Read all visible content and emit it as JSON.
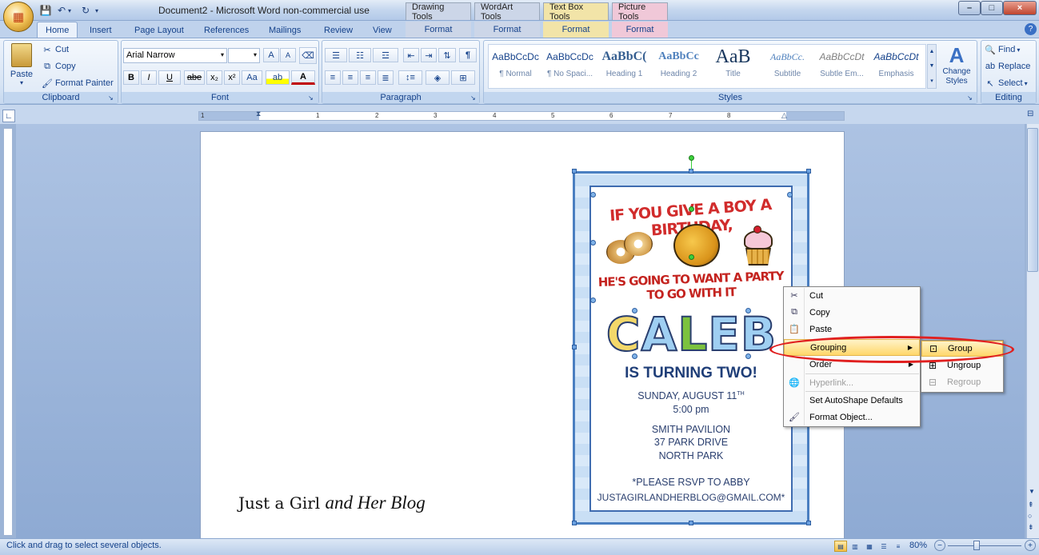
{
  "window": {
    "title": "Document2 - Microsoft Word non-commercial use",
    "context_tabs": [
      "Drawing Tools",
      "WordArt Tools",
      "Text Box Tools",
      "Picture Tools"
    ],
    "context_colors": [
      "#ccd6e8",
      "#ccd6e8",
      "#f2e4a8",
      "#f0c8d8"
    ],
    "minimize": "–",
    "maximize": "□",
    "close": "×"
  },
  "tabs": [
    "Home",
    "Insert",
    "Page Layout",
    "References",
    "Mailings",
    "Review",
    "View"
  ],
  "context_format_tabs": [
    "Format",
    "Format",
    "Format",
    "Format"
  ],
  "clipboard": {
    "paste": "Paste",
    "cut": "Cut",
    "copy": "Copy",
    "format_painter": "Format Painter",
    "label": "Clipboard"
  },
  "font": {
    "name": "Arial Narrow",
    "size": "",
    "label": "Font",
    "bold": "B",
    "italic": "I",
    "underline": "U",
    "strike": "abe",
    "subscript": "x₂",
    "superscript": "x²",
    "change_case": "Aa",
    "grow": "A",
    "shrink": "A"
  },
  "paragraph": {
    "label": "Paragraph"
  },
  "styles": {
    "label": "Styles",
    "items": [
      {
        "sample": "AaBbCcDc",
        "name": "¶ Normal"
      },
      {
        "sample": "AaBbCcDc",
        "name": "¶ No Spaci..."
      },
      {
        "sample": "AaBbC(",
        "name": "Heading 1"
      },
      {
        "sample": "AaBbCc",
        "name": "Heading 2"
      },
      {
        "sample": "AaB",
        "name": "Title"
      },
      {
        "sample": "AaBbCc.",
        "name": "Subtitle"
      },
      {
        "sample": "AaBbCcDt",
        "name": "Subtle Em..."
      },
      {
        "sample": "AaBbCcDt",
        "name": "Emphasis"
      }
    ],
    "change_styles": "Change Styles"
  },
  "editing": {
    "label": "Editing",
    "find": "Find",
    "replace": "Replace",
    "select": "Select"
  },
  "ruler_numbers": [
    "1",
    "1",
    "2",
    "3",
    "4",
    "5",
    "6",
    "7",
    "8"
  ],
  "invitation": {
    "headline": "IF YOU GIVE A BOY A BIRTHDAY,",
    "subheadline": "HE'S GOING TO WANT A PARTY TO GO WITH IT",
    "name_letters": [
      {
        "ch": "C",
        "color": "#f3d86a"
      },
      {
        "ch": "A",
        "color": "#9fcff2"
      },
      {
        "ch": "L",
        "color": "#7cc23e"
      },
      {
        "ch": "E",
        "color": "#9fcff2"
      },
      {
        "ch": "B",
        "color": "#9fcff2"
      }
    ],
    "turning": "IS TURNING TWO!",
    "date": "SUNDAY, AUGUST 11",
    "date_sup": "TH",
    "time": "5:00 pm",
    "venue": "SMITH PAVILION",
    "street": "37 PARK DRIVE",
    "area": "NORTH PARK",
    "rsvp": "*PLEASE RSVP TO ABBY",
    "email": "JUSTAGIRLANDHERBLOG@GMAIL.COM*"
  },
  "context_menu": {
    "items": [
      {
        "label": "Cut",
        "icon": "scissors-icon",
        "glyph": "✂"
      },
      {
        "label": "Copy",
        "icon": "copy-icon",
        "glyph": "⧉"
      },
      {
        "label": "Paste",
        "icon": "paste-icon",
        "glyph": "📋"
      },
      {
        "label": "Grouping",
        "icon": "",
        "glyph": ""
      },
      {
        "label": "Order",
        "icon": "",
        "glyph": ""
      },
      {
        "label": "Hyperlink...",
        "icon": "hyperlink-icon",
        "glyph": "🌐"
      },
      {
        "label": "Set AutoShape Defaults",
        "icon": "",
        "glyph": ""
      },
      {
        "label": "Format Object...",
        "icon": "format-object-icon",
        "glyph": "🖌"
      }
    ],
    "submenu": [
      {
        "label": "Group",
        "icon": "group-icon",
        "glyph": "⊡"
      },
      {
        "label": "Ungroup",
        "icon": "ungroup-icon",
        "glyph": "⊞"
      },
      {
        "label": "Regroup",
        "icon": "regroup-icon",
        "glyph": "⊟"
      }
    ]
  },
  "page_footer": {
    "plain": "Just a Girl",
    "script": "and Her Blog"
  },
  "status": {
    "text": "Click and drag to select several objects.",
    "zoom": "80%",
    "zoom_level_pct": 80
  }
}
